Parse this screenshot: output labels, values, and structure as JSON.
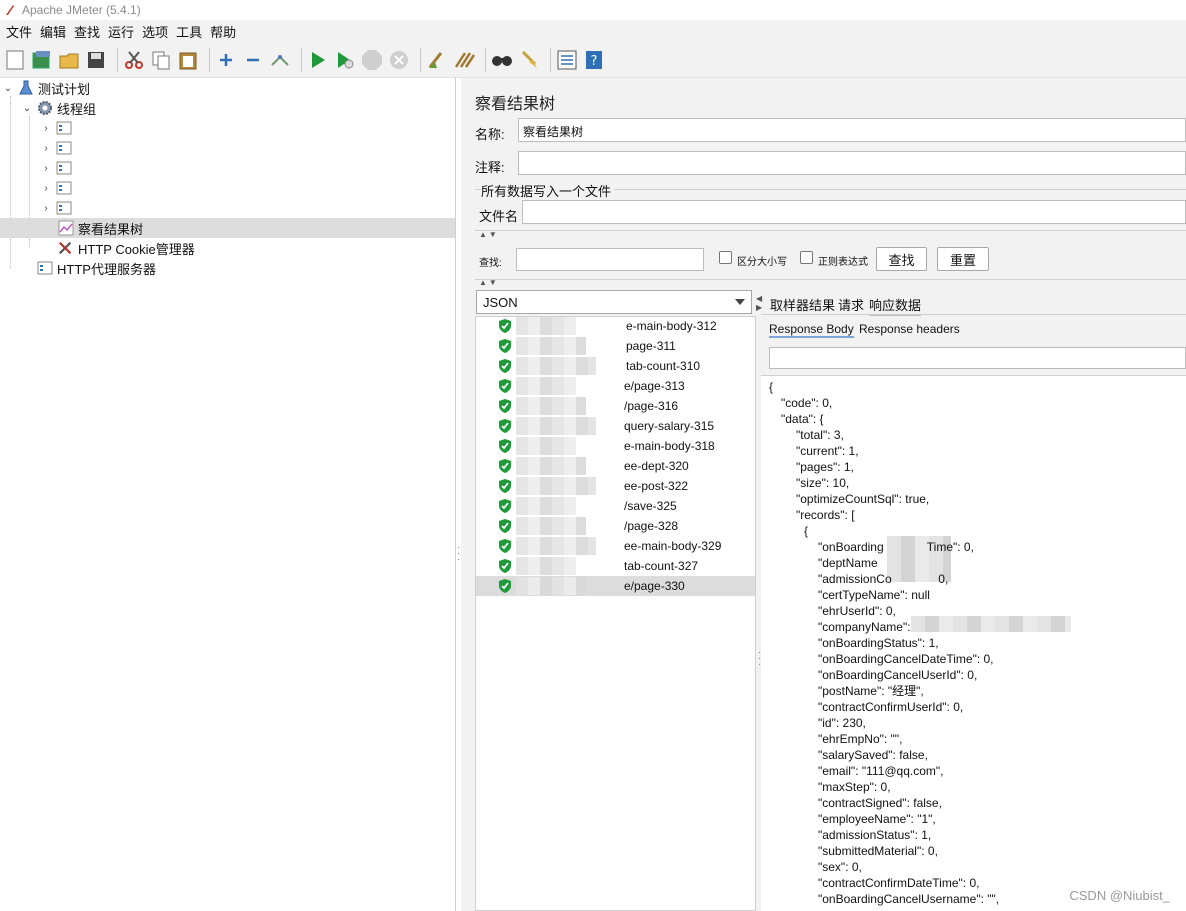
{
  "window": {
    "title": "Apache JMeter (5.4.1)"
  },
  "menu": [
    "文件",
    "编辑",
    "查找",
    "运行",
    "选项",
    "工具",
    "帮助"
  ],
  "toolbar": {
    "icons": [
      "new-icon",
      "templates-icon",
      "open-icon",
      "save-icon",
      "cut-icon",
      "copy-icon",
      "paste-icon",
      "expand-icon",
      "collapse-icon",
      "toggle-icon",
      "start-icon",
      "start-no-pause-icon",
      "stop-icon",
      "shutdown-icon",
      "clear-icon",
      "clear-all-icon",
      "search-icon",
      "reset-search-icon",
      "function-helper-icon",
      "help-icon"
    ]
  },
  "tree": {
    "test_plan": "测试计划",
    "thread_group": "线程组",
    "view_results_tree": "察看结果树",
    "cookie_manager": "HTTP Cookie管理器",
    "proxy_server": "HTTP代理服务器"
  },
  "panel": {
    "title": "察看结果树",
    "name_label": "名称:",
    "name_value": "察看结果树",
    "comment_label": "注释:",
    "comment_value": "",
    "section_title": "所有数据写入一个文件",
    "filename_label": "文件名",
    "filename_value": ""
  },
  "search": {
    "label": "查找:",
    "case_sensitive": "区分大小写",
    "regex": "正则表达式",
    "find_button": "查找",
    "reset_button": "重置"
  },
  "renderer": {
    "selected": "JSON"
  },
  "results": [
    {
      "text": "e-main-body-312"
    },
    {
      "text": "page-311"
    },
    {
      "text": "tab-count-310"
    },
    {
      "text": "e/page-313"
    },
    {
      "text": "/page-316"
    },
    {
      "text": "query-salary-315"
    },
    {
      "text": "e-main-body-318"
    },
    {
      "text": "ee-dept-320"
    },
    {
      "text": "ee-post-322"
    },
    {
      "text": "/save-325"
    },
    {
      "text": "/page-328"
    },
    {
      "text": "ee-main-body-329"
    },
    {
      "text": "tab-count-327"
    },
    {
      "text": "e/page-330"
    }
  ],
  "tabs": {
    "sampler_result": "取样器结果",
    "request": "请求",
    "response_data": "响应数据",
    "response_body": "Response Body",
    "response_headers": "Response headers"
  },
  "response_json": [
    {
      "indent": 0,
      "text": "{"
    },
    {
      "indent": 1,
      "text": "\"code\": 0,"
    },
    {
      "indent": 1,
      "text": "\"data\": {"
    },
    {
      "indent": 2,
      "text": "\"total\": 3,"
    },
    {
      "indent": 2,
      "text": "\"current\": 1,"
    },
    {
      "indent": 2,
      "text": "\"pages\": 1,"
    },
    {
      "indent": 2,
      "text": "\"size\": 10,"
    },
    {
      "indent": 2,
      "text": "\"optimizeCountSql\": true,"
    },
    {
      "indent": 2,
      "text": "\"records\": ["
    },
    {
      "indent": 3,
      "text": "{"
    },
    {
      "indent": 4,
      "text": "\"onBoarding             Time\": 0,"
    },
    {
      "indent": 4,
      "text": "\"deptName"
    },
    {
      "indent": 4,
      "text": "\"admissionCo              0,"
    },
    {
      "indent": 4,
      "text": "\"certTypeName\": null"
    },
    {
      "indent": 4,
      "text": "\"ehrUserId\": 0,"
    },
    {
      "indent": 4,
      "text": "\"companyName\":"
    },
    {
      "indent": 4,
      "text": "\"onBoardingStatus\": 1,"
    },
    {
      "indent": 4,
      "text": "\"onBoardingCancelDateTime\": 0,"
    },
    {
      "indent": 4,
      "text": "\"onBoardingCancelUserId\": 0,"
    },
    {
      "indent": 4,
      "text": "\"postName\": \"经理\","
    },
    {
      "indent": 4,
      "text": "\"contractConfirmUserId\": 0,"
    },
    {
      "indent": 4,
      "text": "\"id\": 230,"
    },
    {
      "indent": 4,
      "text": "\"ehrEmpNo\": \"\","
    },
    {
      "indent": 4,
      "text": "\"salarySaved\": false,"
    },
    {
      "indent": 4,
      "text": "\"email\": \"111@qq.com\","
    },
    {
      "indent": 4,
      "text": "\"maxStep\": 0,"
    },
    {
      "indent": 4,
      "text": "\"contractSigned\": false,"
    },
    {
      "indent": 4,
      "text": "\"employeeName\": \"1\","
    },
    {
      "indent": 4,
      "text": "\"admissionStatus\": 1,"
    },
    {
      "indent": 4,
      "text": "\"submittedMaterial\": 0,"
    },
    {
      "indent": 4,
      "text": "\"sex\": 0,"
    },
    {
      "indent": 4,
      "text": "\"contractConfirmDateTime\": 0,"
    },
    {
      "indent": 4,
      "text": "\"onBoardingCancelUsername\": \"\","
    }
  ],
  "watermark": "CSDN @Niubist_"
}
